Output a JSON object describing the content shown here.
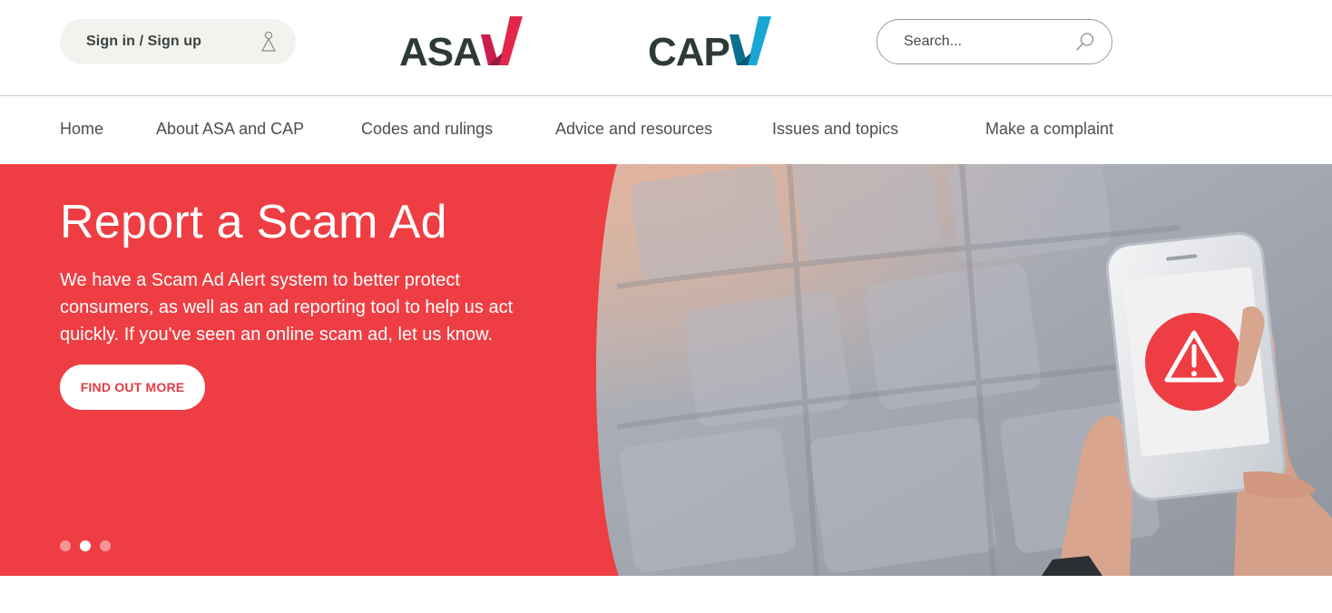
{
  "header": {
    "signin_label": "Sign in / Sign up",
    "logos": {
      "asa_text": "ASA",
      "cap_text": "CAP"
    },
    "search": {
      "placeholder": "Search..."
    }
  },
  "nav": {
    "items": [
      {
        "label": "Home"
      },
      {
        "label": "About ASA and CAP"
      },
      {
        "label": "Codes and rulings"
      },
      {
        "label": "Advice and resources"
      },
      {
        "label": "Issues and topics"
      },
      {
        "label": "Make a complaint"
      }
    ]
  },
  "hero": {
    "title": "Report a Scam Ad",
    "text": "We have a Scam Ad Alert system to better protect consumers, as well as an ad reporting tool to help us act quickly. If you've seen an online scam ad, let us know.",
    "button_label": "FIND OUT MORE",
    "slides": {
      "count": 3,
      "active": 2
    }
  },
  "colors": {
    "brand_red": "#ef3e43",
    "asa_tick": "#e4264a",
    "cap_tick": "#1aa7d4",
    "logo_text": "#2e3a36",
    "nav_text": "#4a514d"
  }
}
